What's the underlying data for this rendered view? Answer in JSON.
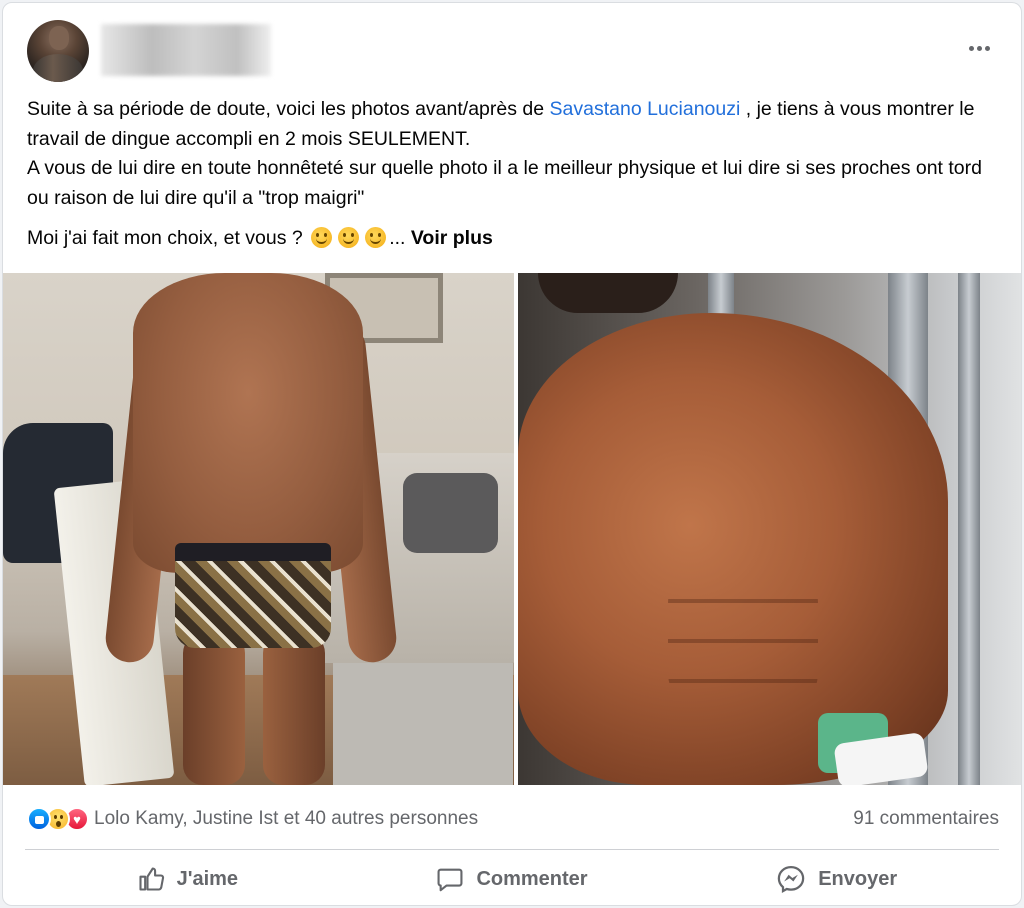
{
  "post": {
    "author": {
      "avatar_icon": "profile-photo",
      "name_blurred": true
    },
    "menu_icon": "more-horizontal-icon",
    "text": {
      "line1_before": "Suite à sa période de doute, voici les photos avant/après de ",
      "mention": "Savastano Lucianouzi",
      "line1_after": " , je tiens à vous montrer le travail de dingue accompli en 2 mois SEULEMENT.",
      "line2": "A vous de lui dire en toute honnêteté sur quelle photo il a le meilleur physique et lui dire si ses proches ont tord ou raison de lui dire qu'il a \"trop maigri\"",
      "line3": "Moi j'ai fait mon choix, et vous ?",
      "ellipsis": "...",
      "see_more": "Voir plus"
    },
    "photos": [
      {
        "name": "before-photo"
      },
      {
        "name": "after-photo"
      }
    ]
  },
  "reactions": {
    "icons": [
      "like-icon",
      "wow-icon",
      "love-icon"
    ],
    "summary": "Lolo Kamy, Justine Ist et 40 autres personnes",
    "comments": "91 commentaires"
  },
  "actions": {
    "like": "J'aime",
    "comment": "Commenter",
    "send": "Envoyer"
  },
  "colors": {
    "mention": "#216fdb",
    "muted": "#65676b",
    "like_blue": "#0062df",
    "love_red": "#e61739"
  }
}
